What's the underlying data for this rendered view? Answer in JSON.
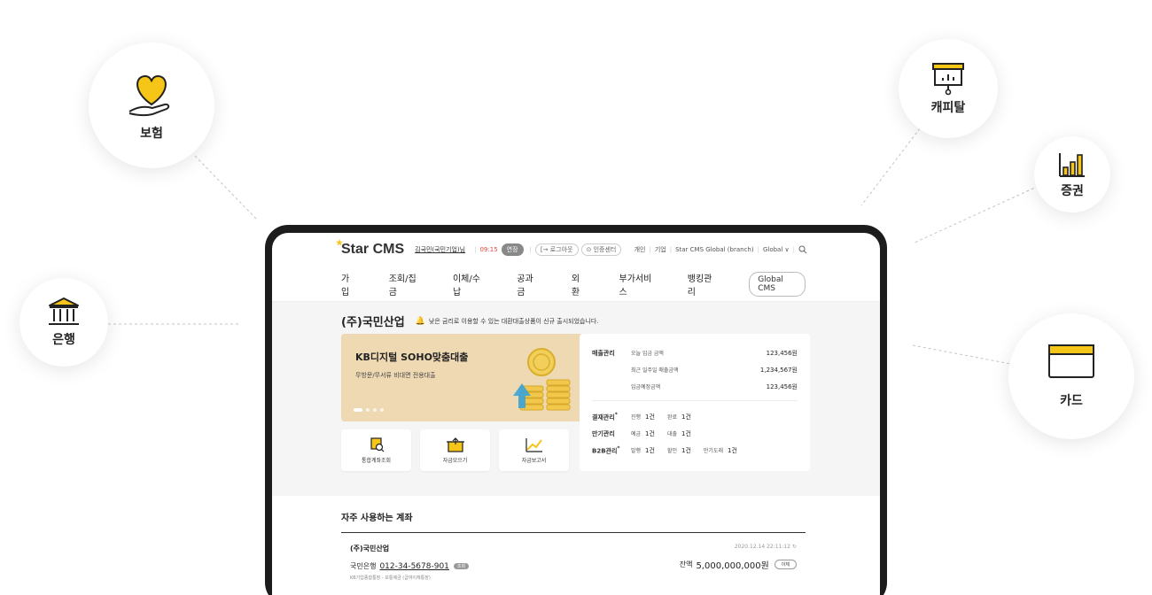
{
  "satellites": {
    "insurance": {
      "label": "보험",
      "icon": "heart-hand-icon"
    },
    "bank": {
      "label": "은행",
      "icon": "bank-icon"
    },
    "capital": {
      "label": "캐피탈",
      "icon": "presentation-icon"
    },
    "securities": {
      "label": "증권",
      "icon": "bar-chart-icon"
    },
    "card": {
      "label": "카드",
      "icon": "credit-card-icon"
    }
  },
  "colors": {
    "accent": "#f5c518",
    "frame": "#1c1c1c",
    "banner": "#eed9b3"
  },
  "topbar": {
    "logo": "Star CMS",
    "user": "김국민(국민기업)님",
    "time": "09:15",
    "extend": "연장",
    "logout": "[→ 로그아웃",
    "cert": "⊙ 인증센터",
    "personal": "개인",
    "enterprise": "기업",
    "global_branch": "Star CMS Global (branch)",
    "global": "Global ∨"
  },
  "nav": {
    "items": [
      "가입",
      "조회/집금",
      "이체/수납",
      "공과금",
      "외환",
      "부가서비스",
      "뱅킹관리"
    ],
    "global_cms": "Global CMS"
  },
  "main": {
    "company": "(주)국민산업",
    "notice": "낮은 금리로 이용할 수 있는 대환대출상품이 신규 출시되었습니다.",
    "banner": {
      "title": "KB디지털 SOHO맞춤대출",
      "subtitle": "무방문/무서류 비대면 전용대출"
    },
    "quick": [
      {
        "label": "통합계좌조회",
        "icon": "account-search-icon"
      },
      {
        "label": "자금모으기",
        "icon": "fund-collect-icon"
      },
      {
        "label": "자금보고서",
        "icon": "report-chart-icon"
      }
    ],
    "panel": {
      "sales_title": "매출관리",
      "sales": [
        {
          "label": "오늘 입금 금액",
          "value": "123,456원"
        },
        {
          "label": "최근 일주일 매출금액",
          "value": "1,234,567원"
        },
        {
          "label": "입금예정금액",
          "value": "123,456원"
        }
      ],
      "settlement": {
        "title": "결재관리",
        "a_label": "진행",
        "a_value": "1건",
        "b_label": "완료",
        "b_value": "1건"
      },
      "maturity": {
        "title": "만기관리",
        "a_label": "예금",
        "a_value": "1건",
        "b_label": "대출",
        "b_value": "1건"
      },
      "b2b": {
        "title": "B2B관리",
        "a_label": "발행",
        "a_value": "1건",
        "b_label": "할인",
        "b_value": "1건",
        "c_label": "만기도래",
        "c_value": "1건"
      }
    }
  },
  "accounts": {
    "section_title": "자주 사용하는 계좌",
    "item": {
      "company": "(주)국민산업",
      "bank": "국민은행",
      "number": "012-34-5678-901",
      "tag": "조회",
      "desc": "KB기업종합통장 - 보통예금 (급여이체통장)",
      "timestamp": "2020.12.14 22:11:12",
      "balance_label": "잔액",
      "balance": "5,000,000,000원",
      "transfer": "이체"
    }
  }
}
